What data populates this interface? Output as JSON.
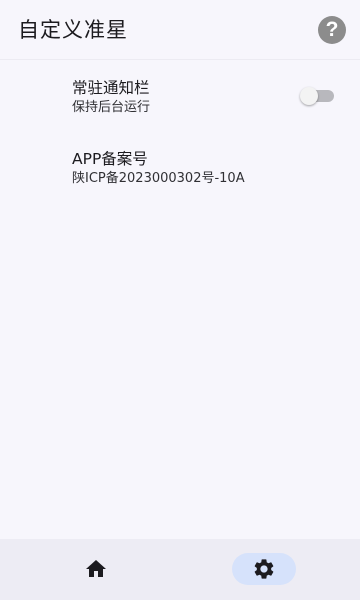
{
  "app_bar": {
    "title": "自定义准星",
    "help_label": "?"
  },
  "settings": {
    "notify": {
      "title": "常驻通知栏",
      "subtitle": "保持后台运行",
      "enabled": false
    },
    "icp": {
      "title": "APP备案号",
      "subtitle": "陕ICP备2023000302号-10A"
    }
  },
  "bottom_nav": {
    "items": [
      {
        "icon": "home-icon",
        "selected": false
      },
      {
        "icon": "gear-icon",
        "selected": true
      }
    ]
  },
  "colors": {
    "background": "#f7f6fc",
    "nav_background": "#edecf4",
    "nav_selected_pill": "#d6e2fb",
    "help_icon": "#8c8c8c",
    "switch_off_track": "#b8b8bd",
    "icon": "#1c1b1f"
  }
}
